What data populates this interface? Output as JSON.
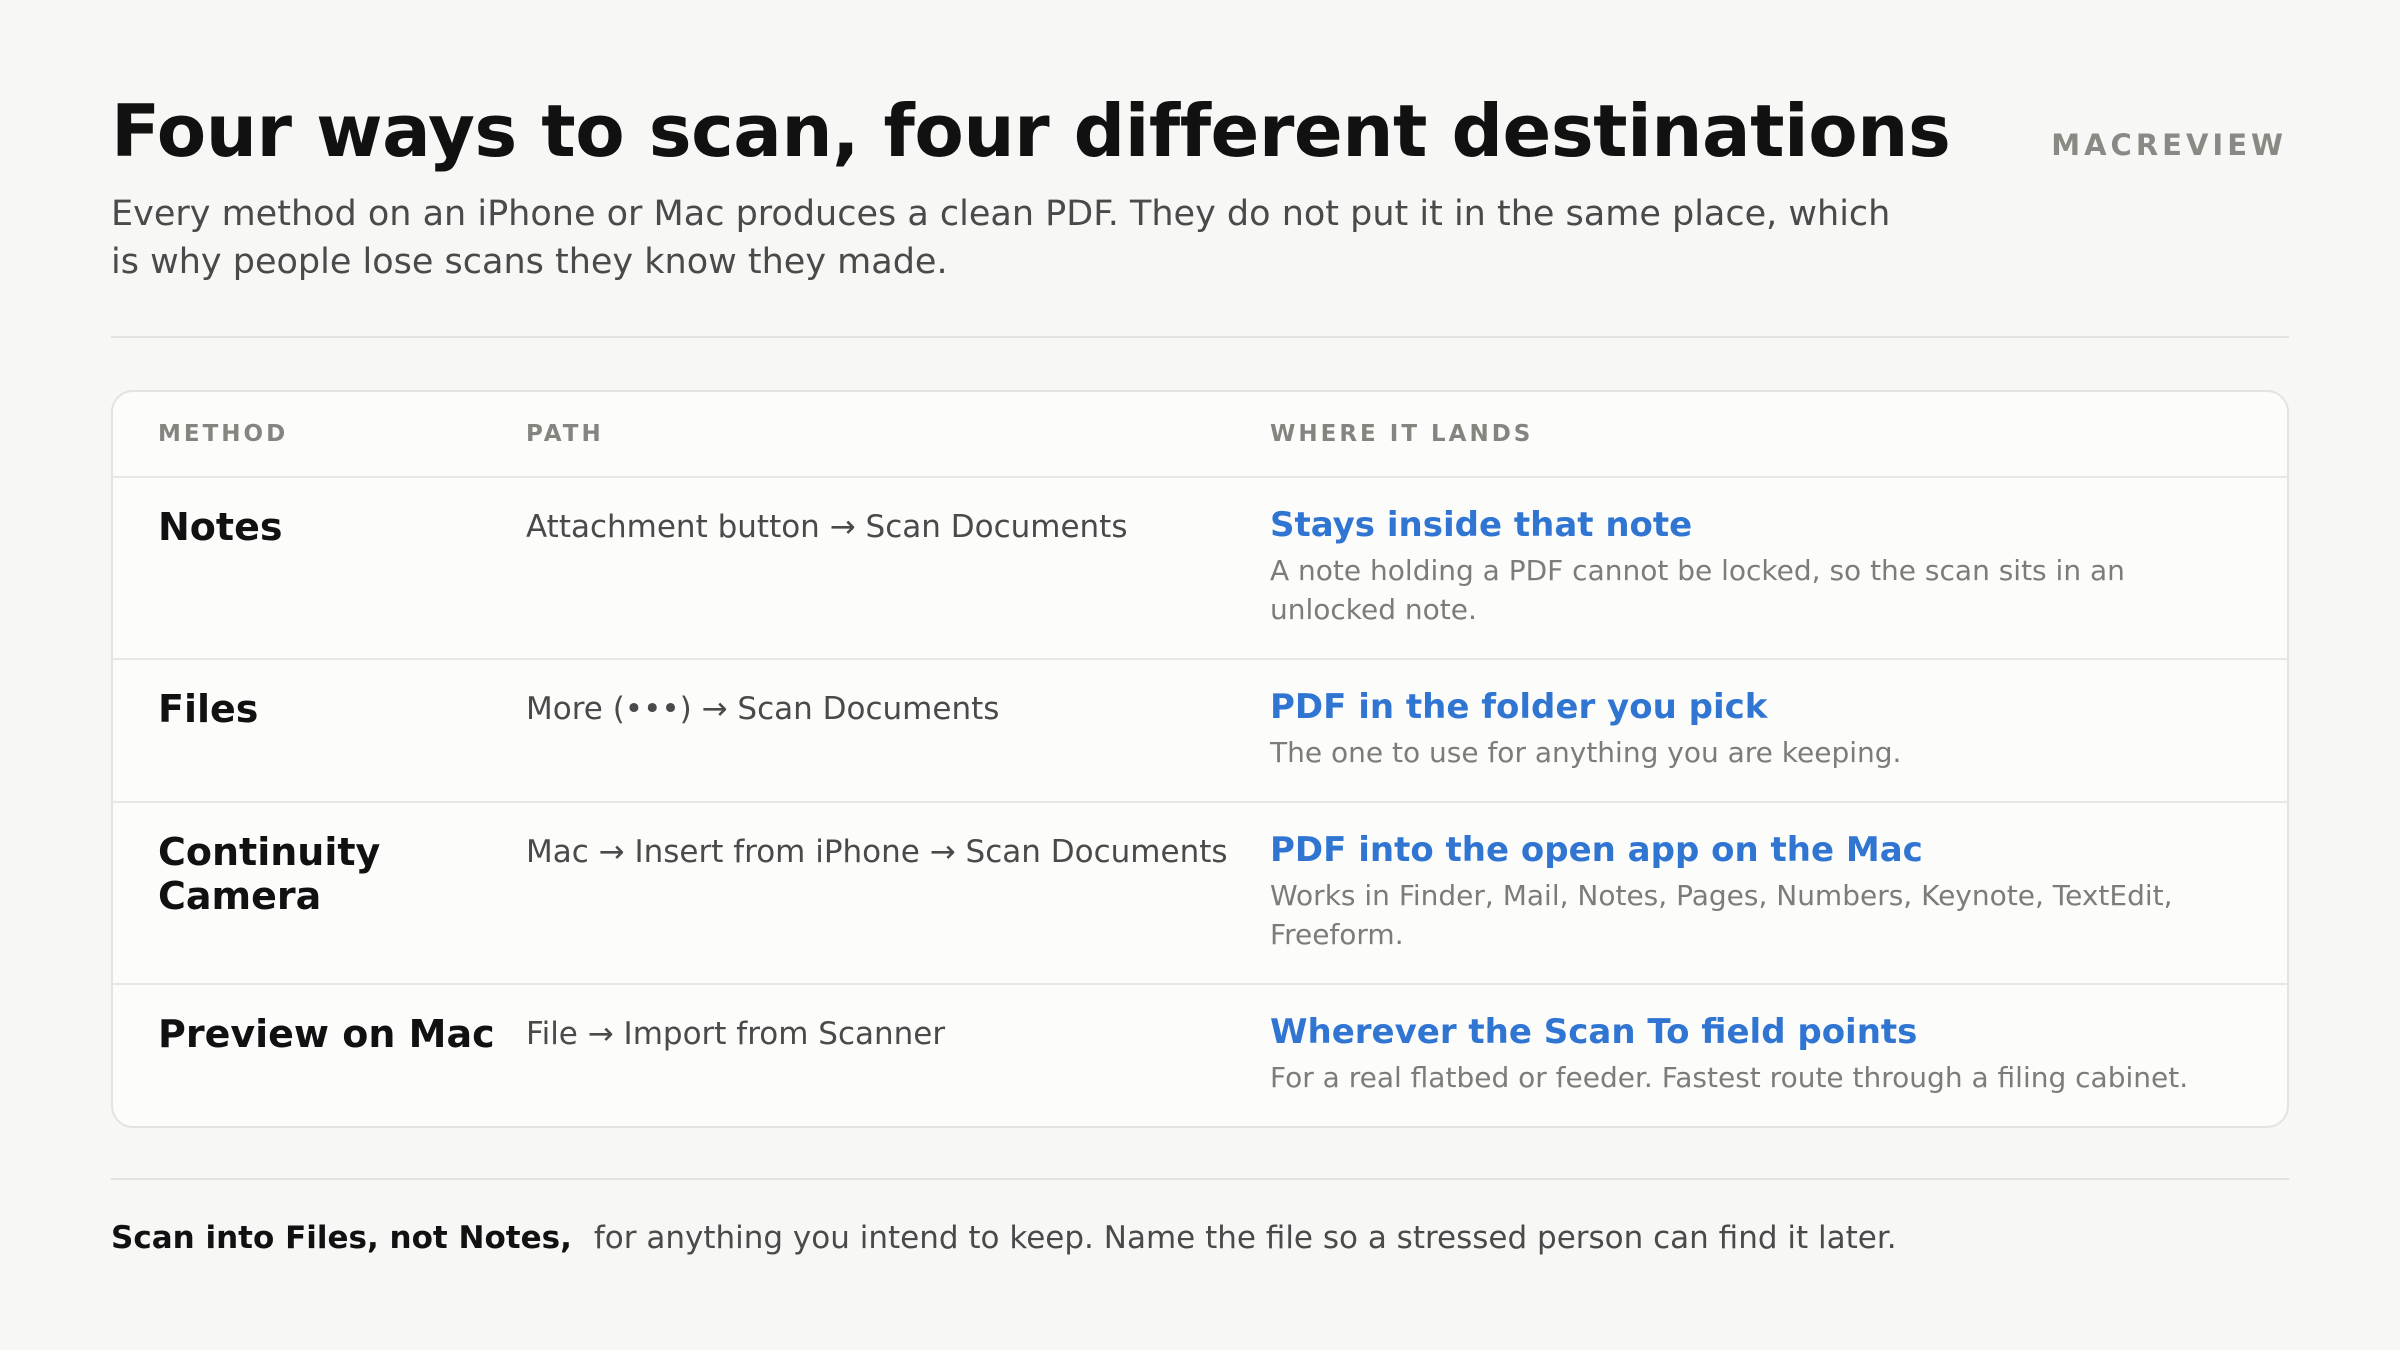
{
  "header": {
    "title": "Four ways to scan, four different destinations",
    "brand": "MACREVIEW",
    "subtitle": "Every method on an iPhone or Mac produces a clean PDF. They do not put it in the same place, which is why people lose scans they know they made."
  },
  "table": {
    "columns": [
      "METHOD",
      "PATH",
      "WHERE IT LANDS"
    ],
    "rows": [
      {
        "method": "Notes",
        "path": "Attachment button → Scan Documents",
        "land_title": "Stays inside that note",
        "land_desc": "A note holding a PDF cannot be locked, so the scan sits in an unlocked note."
      },
      {
        "method": "Files",
        "path": "More (•••) → Scan Documents",
        "land_title": "PDF in the folder you pick",
        "land_desc": "The one to use for anything you are keeping."
      },
      {
        "method": "Continuity Camera",
        "path": "Mac → Insert from iPhone → Scan Documents",
        "land_title": "PDF into the open app on the Mac",
        "land_desc": "Works in Finder, Mail, Notes, Pages, Numbers, Keynote, TextEdit, Freeform."
      },
      {
        "method": "Preview on Mac",
        "path": "File → Import from Scanner",
        "land_title": "Wherever the Scan To field points",
        "land_desc": "For a real flatbed or feeder. Fastest route through a filing cabinet."
      }
    ]
  },
  "footer": {
    "strong": "Scan into Files, not Notes,",
    "text": "for anything you intend to keep. Name the file so a stressed person can find it later."
  },
  "colors": {
    "accent": "#2f75d1",
    "background": "#f7f7f5",
    "text": "#111111"
  }
}
